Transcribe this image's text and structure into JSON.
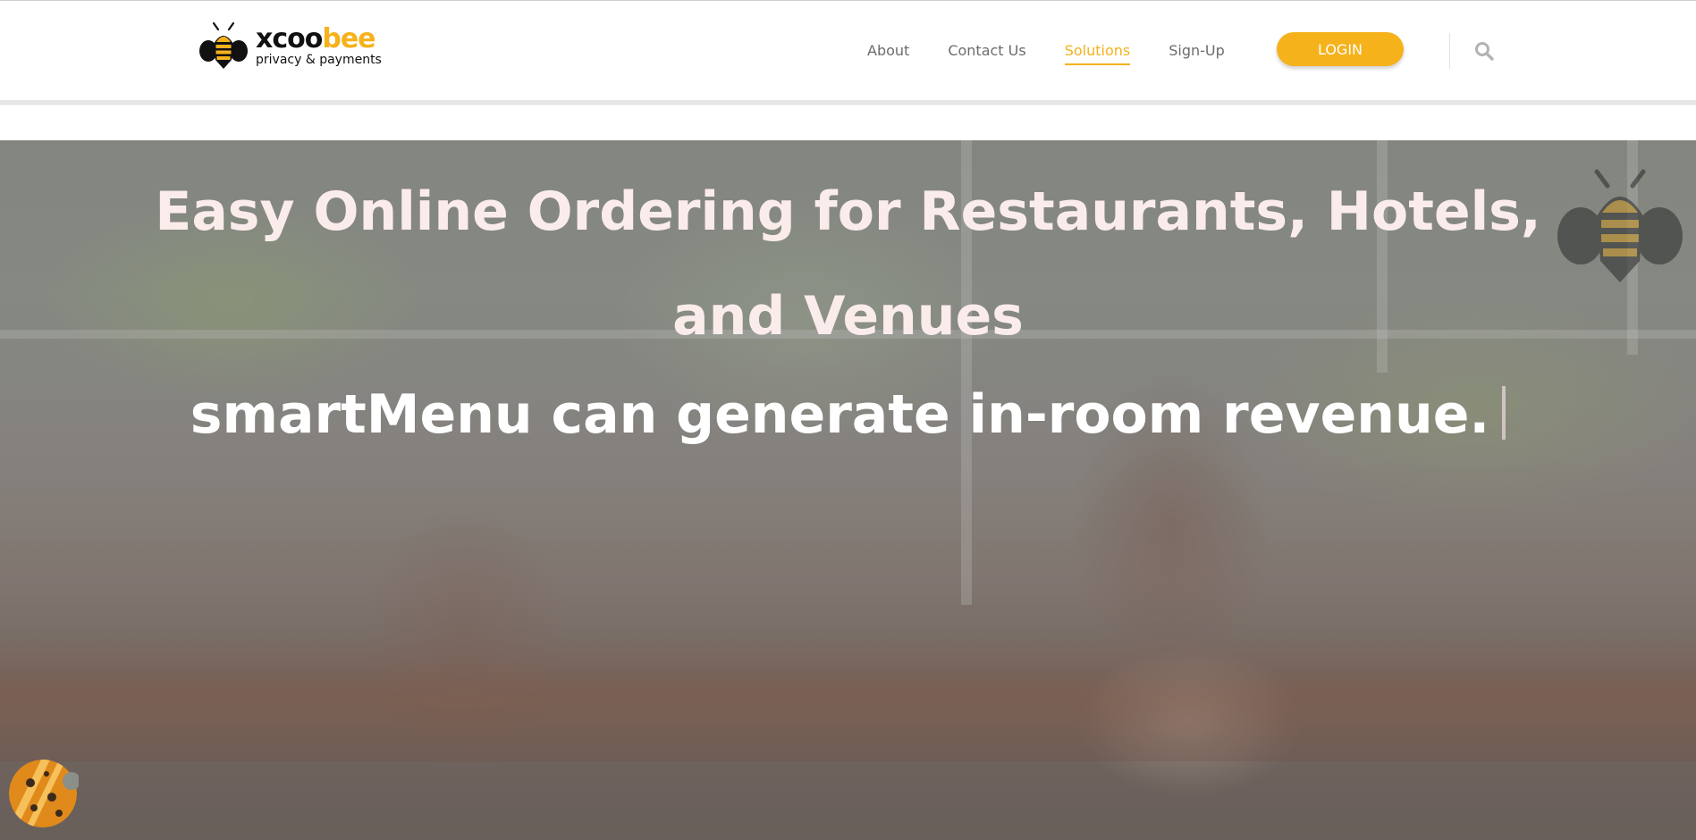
{
  "logo": {
    "word_black": "xcoo",
    "word_gold": "bee",
    "tagline": "privacy & payments",
    "icon": "bee-icon"
  },
  "nav": {
    "items": [
      {
        "label": "About",
        "active": false
      },
      {
        "label": "Contact Us",
        "active": false
      },
      {
        "label": "Solutions",
        "active": true
      },
      {
        "label": "Sign-Up",
        "active": false
      }
    ],
    "login_label": "LOGIN",
    "search_icon": "search-icon"
  },
  "hero": {
    "title": "Easy Online Ordering for Restaurants, Hotels, and Venues",
    "subtitle": "smartMenu can generate in-room revenue.",
    "decor_icon": "bee-icon"
  },
  "cookie": {
    "icon": "cookie-icon"
  },
  "colors": {
    "accent": "#f5b21b",
    "nav_text": "#6c6c6c",
    "title_text": "#fbecec",
    "subtitle_text": "#ffffff"
  }
}
